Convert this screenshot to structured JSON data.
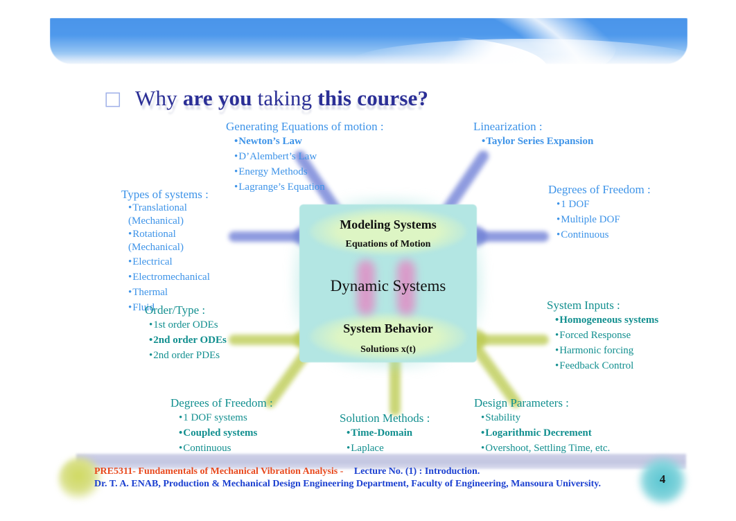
{
  "slide": {
    "number": "4",
    "title_bullet": "box-glyph-icon",
    "title_prefix": "Why ",
    "title_bold1": "are you",
    "title_mid": " taking ",
    "title_bold2": "this course?"
  },
  "center": {
    "modeling": "Modeling Systems",
    "equations": "Equations of Motion",
    "dynamic": "Dynamic Systems",
    "behavior": "System Behavior",
    "solutions": "Solutions  x(t)"
  },
  "groups": {
    "generating": {
      "heading": "Generating Equations of motion :",
      "items": [
        "Newton’s Law",
        "D’Alembert’s Law",
        "Energy Methods",
        "Lagrange’s Equation"
      ],
      "bold": [
        true,
        false,
        false,
        false
      ]
    },
    "linearization": {
      "heading": "Linearization :",
      "items": [
        "Taylor Series Expansion"
      ],
      "bold": [
        true
      ]
    },
    "types": {
      "heading": "Types of systems :",
      "items": [
        "Translational (Mechanical)",
        "Rotational (Mechanical)",
        "Electrical",
        "Electromechanical",
        "Thermal",
        "Fluid"
      ],
      "bold": [
        false,
        false,
        false,
        false,
        false,
        false
      ]
    },
    "dof_right": {
      "heading": "Degrees of Freedom :",
      "items": [
        "1 DOF",
        "Multiple DOF",
        "Continuous"
      ],
      "bold": [
        false,
        false,
        false
      ]
    },
    "order": {
      "heading": "Order/Type :",
      "items": [
        "1st order ODEs",
        "2nd order ODEs",
        "2nd order PDEs"
      ],
      "bold": [
        false,
        true,
        false
      ]
    },
    "inputs": {
      "heading": "System Inputs :",
      "items": [
        "Homogeneous systems",
        "Forced Response",
        "Harmonic forcing",
        "Feedback Control"
      ],
      "bold": [
        true,
        false,
        false,
        false
      ]
    },
    "dof_bottom": {
      "heading": "Degrees of Freedom :",
      "items": [
        "1 DOF systems",
        "Coupled systems",
        "Continuous"
      ],
      "bold": [
        false,
        true,
        false
      ]
    },
    "solution_methods": {
      "heading": "Solution Methods :",
      "items": [
        "Time-Domain",
        "Laplace"
      ],
      "bold": [
        true,
        false
      ]
    },
    "design": {
      "heading": "Design Parameters :",
      "items": [
        "Stability",
        "Logarithmic Decrement",
        "Overshoot, Settling Time, etc."
      ],
      "bold": [
        false,
        true,
        false
      ]
    }
  },
  "footer": {
    "course_code": "PRE5311- Fundamentals of Mechanical Vibration Analysis -",
    "lecture": "Lecture No. (1) : Introduction.",
    "author": "Dr. T. A. ENAB, Production & Mechanical Design Engineering Department, Faculty of Engineering, Mansoura University."
  },
  "colors": {
    "title": "#2b2f96",
    "blue_text": "#3d93e8",
    "teal_text": "#128f8f",
    "box_fill": "#b3e6e3",
    "arrow_blue": "#6f7fd6",
    "arrow_green": "#bccb52",
    "footer_code": "#e8491d",
    "footer_author": "#1a3fd0"
  }
}
